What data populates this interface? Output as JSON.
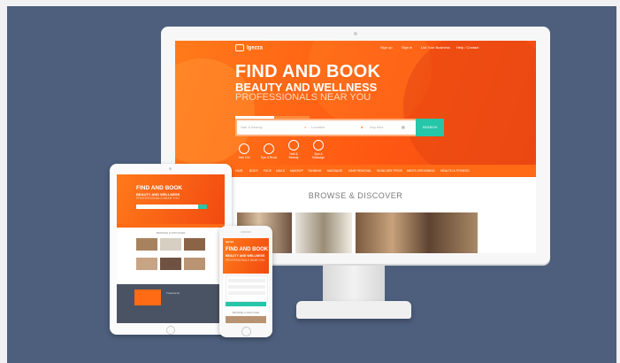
{
  "monitor": {
    "logo": "Igezza",
    "nav": [
      "Sign up",
      "Sign in",
      "List Your Business",
      "Help / Contact"
    ],
    "headline": "FIND AND BOOK",
    "subheadline": "BEAUTY AND WELLNESS",
    "tagline": "PROFESSIONALS NEAR YOU",
    "tabs": [
      "BOOK TREATMENT",
      "EXPERT ADVICE"
    ],
    "search": {
      "treatment_placeholder": "Hair & Beauty",
      "location_placeholder": "Location",
      "date_placeholder": "Any time",
      "button": "SEARCH"
    },
    "categories": [
      "Hair Cut",
      "Eye & Brow",
      "Nail & Beauty",
      "Spa & Massage"
    ],
    "category_bar": [
      "HAIR",
      "BODY",
      "FACE",
      "NAILS",
      "MAKEUP",
      "TANNING",
      "MASSAGE",
      "HAIR REMOVAL",
      "SKINCARE PROS",
      "MEN'S GROOMING",
      "HEALTH & FITNESS"
    ],
    "browse_heading": "BROWSE & DISCOVER"
  },
  "tablet": {
    "headline": "FIND AND BOOK",
    "subheadline": "BEAUTY AND WELLNESS",
    "tagline": "PROFESSIONALS NEAR YOU",
    "browse_heading": "BROWSE & DISCOVER",
    "promo_text": "Treatments"
  },
  "phone": {
    "logo": "Igezza",
    "headline": "FIND AND BOOK",
    "subheadline": "BEAUTY AND WELLNESS",
    "tagline": "PROFESSIONALS NEAR YOU",
    "browse_heading": "BROWSE & DISCOVER"
  },
  "colors": {
    "background": "#4d5f7d",
    "brand_orange": "#ff6a14",
    "accent_teal": "#26c6a8"
  }
}
